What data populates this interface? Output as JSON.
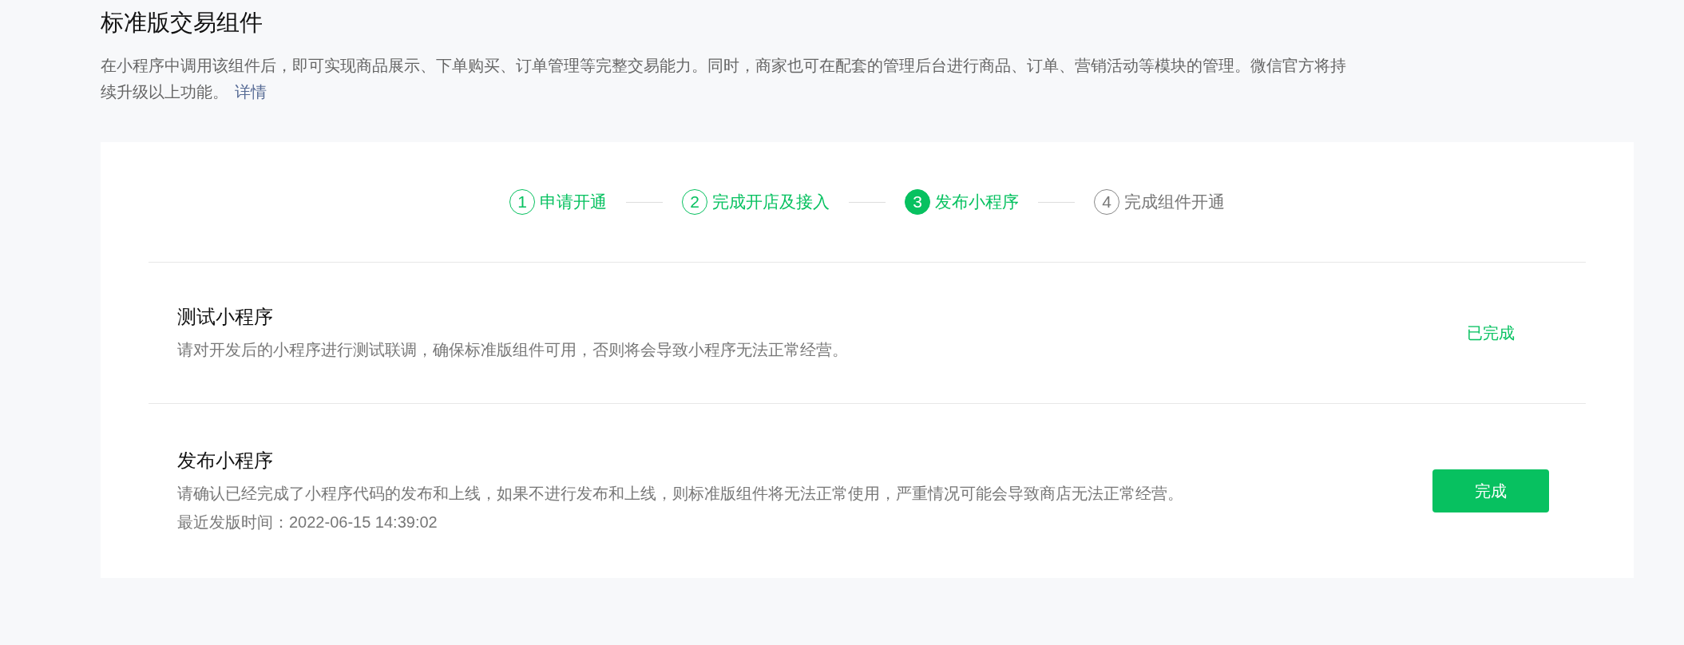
{
  "header": {
    "title": "标准版交易组件",
    "description": "在小程序中调用该组件后，即可实现商品展示、下单购买、订单管理等完整交易能力。同时，商家也可在配套的管理后台进行商品、订单、营销活动等模块的管理。微信官方将持续升级以上功能。",
    "link": "详情"
  },
  "steps": [
    {
      "number": "1",
      "label": "申请开通",
      "completed": true,
      "selected": false
    },
    {
      "number": "2",
      "label": "完成开店及接入",
      "completed": true,
      "selected": false
    },
    {
      "number": "3",
      "label": "发布小程序",
      "completed": false,
      "selected": true
    },
    {
      "number": "4",
      "label": "完成组件开通",
      "completed": false,
      "selected": false
    }
  ],
  "tasks": [
    {
      "title": "测试小程序",
      "description": "请对开发后的小程序进行测试联调，确保标准版组件可用，否则将会导致小程序无法正常经营。",
      "action": {
        "kind": "status",
        "text": "已完成"
      }
    },
    {
      "title": "发布小程序",
      "description": "请确认已经完成了小程序代码的发布和上线，如果不进行发布和上线，则标准版组件将无法正常使用，严重情况可能会导致商店无法正常经营。",
      "note": "最近发版时间：2022-06-15 14:39:02",
      "action": {
        "kind": "button",
        "text": "完成"
      }
    }
  ]
}
